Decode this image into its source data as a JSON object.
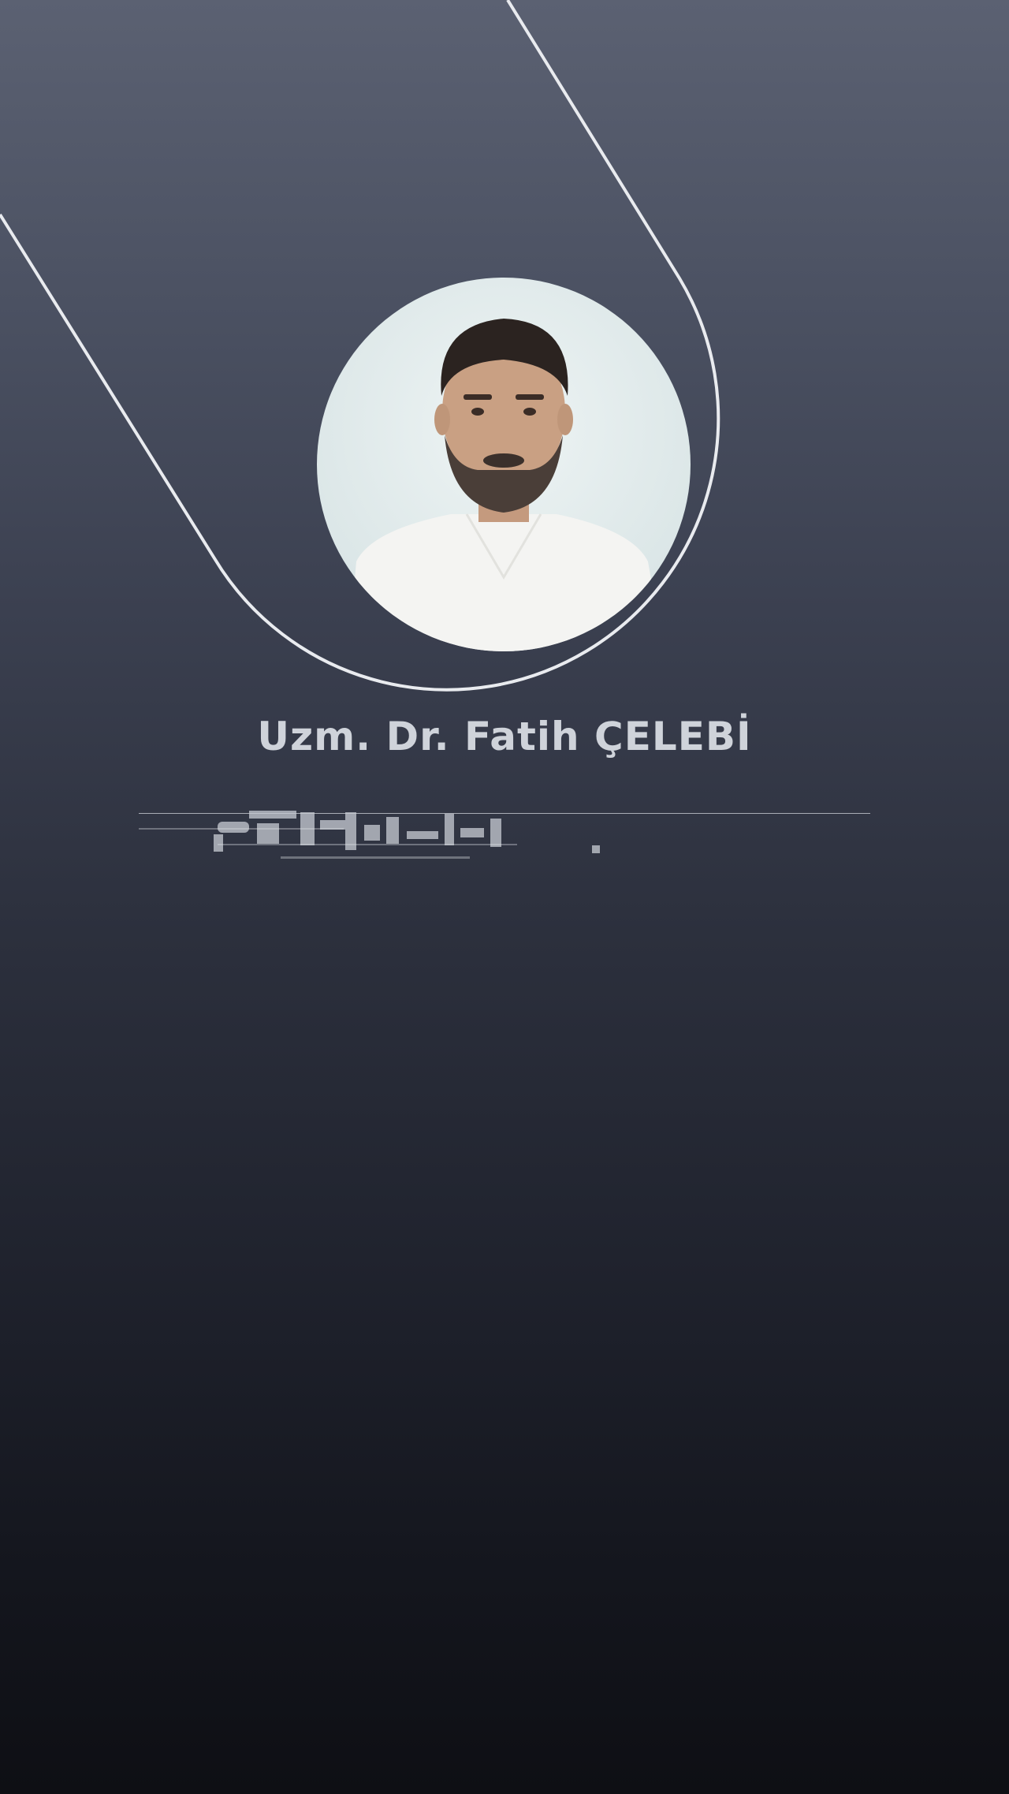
{
  "profile": {
    "name": "Uzm. Dr. Fatih ÇELEBİ",
    "photo_icon": "doctor-portrait"
  },
  "colors": {
    "background_top": "#5b6172",
    "background_bottom": "#0e0f14",
    "outline": "#e9ebef",
    "name_text": "#cfd3da"
  }
}
